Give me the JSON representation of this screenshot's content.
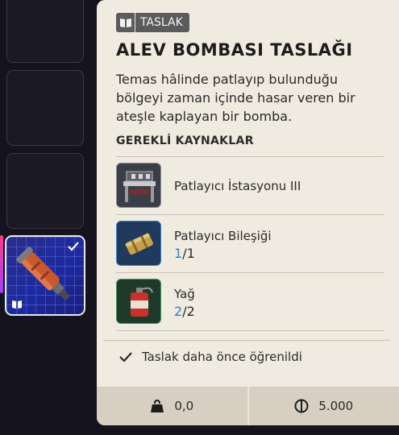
{
  "inventory": {
    "selected_slot": {
      "icon": "flame-bomb-blueprint-icon",
      "learned": true
    }
  },
  "tooltip": {
    "badge_label": "TASLAK",
    "title": "ALEV BOMBASI TASLAĞI",
    "description": "Temas hâlinde patlayıp bulunduğu bölgeyi zaman içinde hasar veren bir ateşle kaplayan bir bomba.",
    "requirements_title": "GEREKLİ KAYNAKLAR",
    "requirements": [
      {
        "name": "Patlayıcı İstasyonu III",
        "icon": "workbench-icon",
        "rarity_color": "#8b8f98"
      },
      {
        "name": "Patlayıcı Bileşiği",
        "have": "1",
        "need": "/1",
        "icon": "explosive-compound-icon",
        "rarity_color": "#3d82c4"
      },
      {
        "name": "Yağ",
        "have": "2",
        "need": "/2",
        "icon": "oil-canister-icon",
        "rarity_color": "#3f9a5c"
      }
    ],
    "learned_text": "Taslak daha önce öğrenildi",
    "weight_value": "0,0",
    "price_value": "5.000"
  },
  "colors": {
    "panel_bg": "#f0ebe0",
    "footer_bg": "#d6cfc2",
    "count_accent": "#3a7db7",
    "selected_slot_bg": "#1d2aa0"
  }
}
